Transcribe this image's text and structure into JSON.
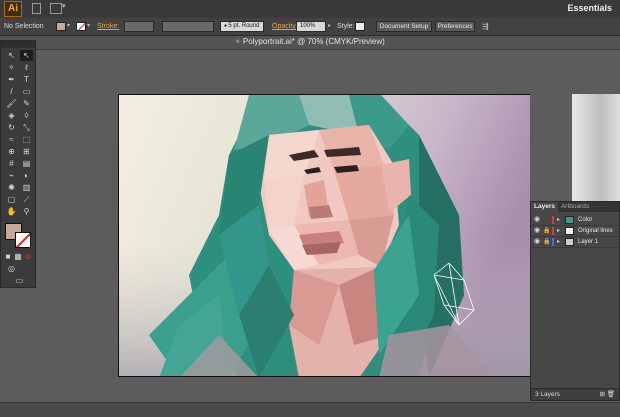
{
  "app": {
    "logo": "Ai",
    "workspace": "Essentials"
  },
  "controlbar": {
    "selection": "No Selection",
    "stroke_label": "Stroke:",
    "brush_label": "5 pt. Round",
    "opacity_label": "Opacity:",
    "opacity_value": "100%",
    "style_label": "Style:",
    "document_setup": "Document Setup",
    "preferences": "Preferences"
  },
  "document": {
    "tab_title": "Polyportrait.ai* @ 70% (CMYK/Preview)"
  },
  "layers_panel": {
    "tabs": [
      "Layers",
      "Artboards"
    ],
    "layers": [
      {
        "name": "Color",
        "color": "#d93a3a",
        "locked": false
      },
      {
        "name": "Original lines",
        "color": "#d93a3a",
        "locked": true
      },
      {
        "name": "Layer 1",
        "color": "#3d6ff0",
        "locked": false
      }
    ],
    "footer": "3 Layers"
  },
  "colors": {
    "fill": "#c9a89a",
    "accent": "#e8a441",
    "teal": "#2f9c86"
  }
}
